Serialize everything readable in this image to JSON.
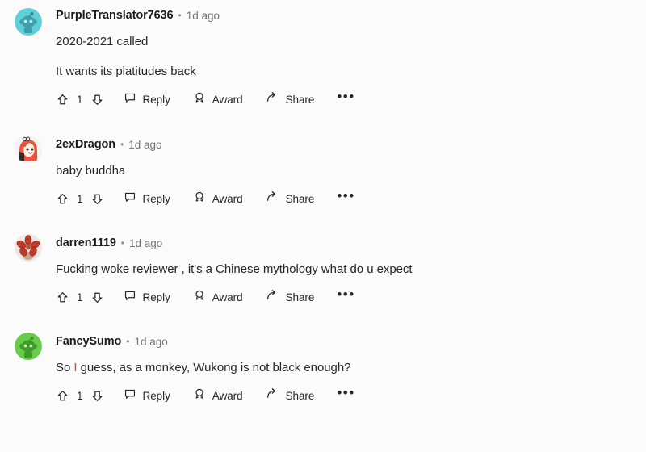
{
  "page": {
    "title": "Reddit comment thread",
    "background_color": "#fbfbfb",
    "text_color": "#26262b",
    "muted_color": "#6f7477",
    "highlight_color": "#d94a2b"
  },
  "actions": {
    "upvote_icon": "upvote-arrow-icon",
    "downvote_icon": "downvote-arrow-icon",
    "reply_icon": "comment-bubble-icon",
    "reply_label": "Reply",
    "award_icon": "award-badge-icon",
    "award_label": "Award",
    "share_icon": "share-arrow-icon",
    "share_label": "Share",
    "more_label": "•••",
    "meta_separator": "•"
  },
  "comments": [
    {
      "username": "PurpleTranslator7636",
      "timestamp": "1d ago",
      "score": "1",
      "avatar": {
        "name": "avatar-snoo-cyan",
        "bg": "#5fd0d8",
        "body": "#3f9fa8"
      },
      "paragraphs": [
        {
          "text": "2020-2021 called"
        },
        {
          "text": "It wants its platitudes back"
        }
      ]
    },
    {
      "username": "2exDragon",
      "timestamp": "1d ago",
      "score": "1",
      "avatar": {
        "name": "avatar-hooded-character-orange",
        "bg": "#f2f2f2",
        "body": "#e8553a"
      },
      "paragraphs": [
        {
          "text": "baby buddha"
        }
      ]
    },
    {
      "username": "darren1119",
      "timestamp": "1d ago",
      "score": "1",
      "avatar": {
        "name": "avatar-red-flower",
        "bg": "#ece7e2",
        "body": "#c1392b"
      },
      "paragraphs": [
        {
          "text": "Fucking woke reviewer , it's a Chinese mythology what do u expect"
        }
      ]
    },
    {
      "username": "FancySumo",
      "timestamp": "1d ago",
      "score": "1",
      "avatar": {
        "name": "avatar-snoo-green",
        "bg": "#66cc4a",
        "body": "#3f9a2a"
      },
      "paragraphs": [
        {
          "prefix": "So ",
          "highlight": "I",
          "suffix": " guess, as a monkey, Wukong is not black enough?"
        }
      ]
    }
  ]
}
